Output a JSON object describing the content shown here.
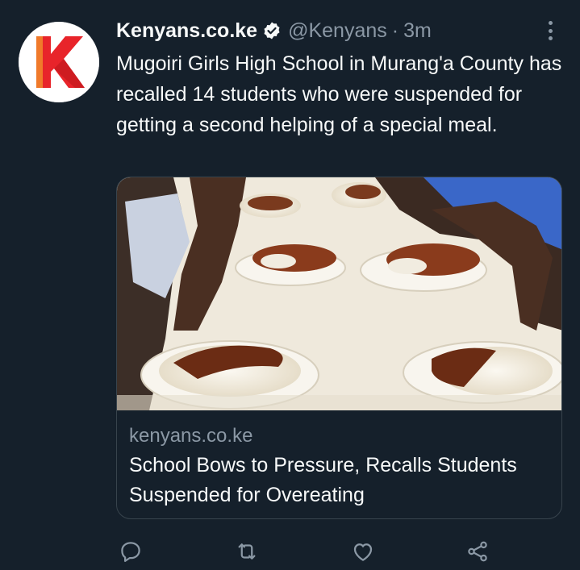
{
  "tweet": {
    "author_name": "Kenyans.co.ke",
    "handle": "@Kenyans",
    "separator": "·",
    "time": "3m",
    "text": "Mugoiri Girls High School in Murang'a County has recalled 14 students who were suspended for getting a second helping of a special meal.",
    "avatar_letter": "K"
  },
  "card": {
    "domain": "kenyans.co.ke",
    "title": "School Bows to Pressure, Recalls Students Suspended for Overeating"
  },
  "icons": {
    "verified": "verified-badge-icon",
    "more": "more-options-icon",
    "reply": "reply-icon",
    "retweet": "retweet-icon",
    "like": "like-icon",
    "share": "share-icon"
  },
  "colors": {
    "background": "#15202b",
    "text_primary": "#f7f9f9",
    "text_secondary": "#8b98a5",
    "border": "#38444d",
    "brand_red": "#e8242a"
  }
}
